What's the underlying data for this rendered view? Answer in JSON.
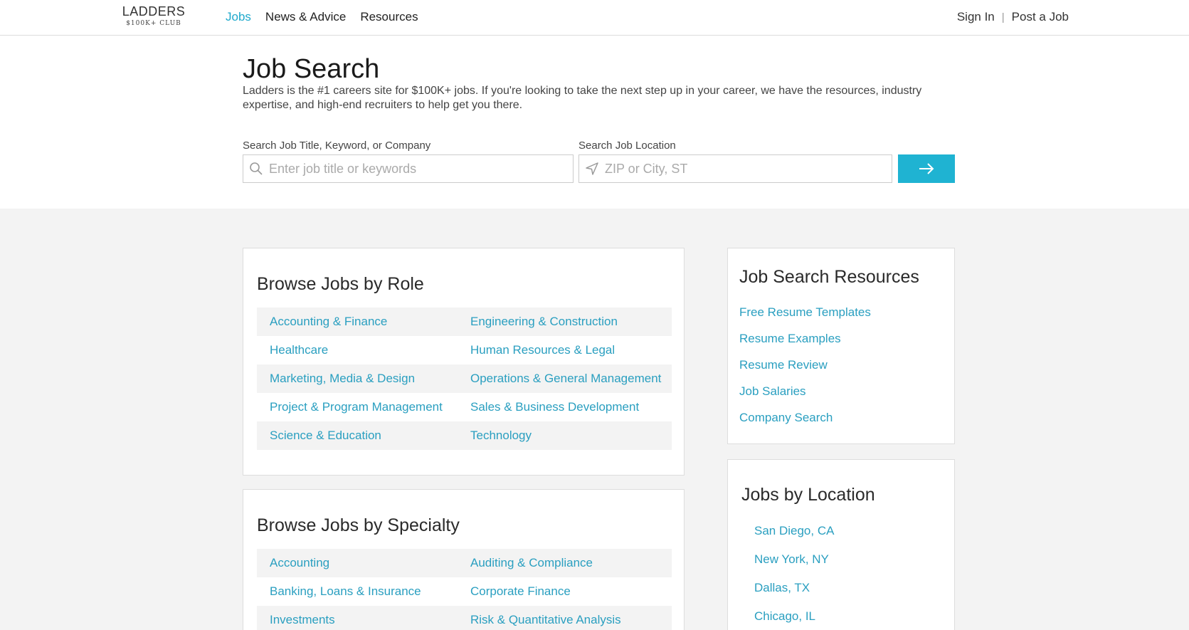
{
  "header": {
    "logo_main": "LADDERS",
    "logo_sub": "$100K+ CLUB",
    "nav": [
      "Jobs",
      "News & Advice",
      "Resources"
    ],
    "sign_in": "Sign In",
    "separator": "|",
    "post_job": "Post a Job"
  },
  "hero": {
    "title": "Job Search",
    "description": "Ladders is the #1 careers site for $100K+ jobs. If you're looking to take the next step up in your career, we have the resources, industry expertise, and high-end recruiters to help get you there.",
    "keyword_label": "Search Job Title, Keyword, or Company",
    "keyword_placeholder": "Enter job title or keywords",
    "location_label": "Search Job Location",
    "location_placeholder": "ZIP or City, ST"
  },
  "role_card": {
    "title": "Browse Jobs by Role",
    "rows": [
      [
        "Accounting & Finance",
        "Engineering & Construction"
      ],
      [
        "Healthcare",
        "Human Resources & Legal"
      ],
      [
        "Marketing, Media & Design",
        "Operations & General Management"
      ],
      [
        "Project & Program Management",
        "Sales & Business Development"
      ],
      [
        "Science & Education",
        "Technology"
      ]
    ]
  },
  "specialty_card": {
    "title": "Browse Jobs by Specialty",
    "rows": [
      [
        "Accounting",
        "Auditing & Compliance"
      ],
      [
        "Banking, Loans & Insurance",
        "Corporate Finance"
      ],
      [
        "Investments",
        "Risk & Quantitative Analysis"
      ]
    ]
  },
  "resources_card": {
    "title": "Job Search Resources",
    "links": [
      "Free Resume Templates",
      "Resume Examples",
      "Resume Review",
      "Job Salaries",
      "Company Search"
    ]
  },
  "location_card": {
    "title": "Jobs by Location",
    "links": [
      "San Diego, CA",
      "New York, NY",
      "Dallas, TX",
      "Chicago, IL"
    ]
  },
  "colors": {
    "accent": "#1fb3d2",
    "link": "#2a9fc0"
  }
}
